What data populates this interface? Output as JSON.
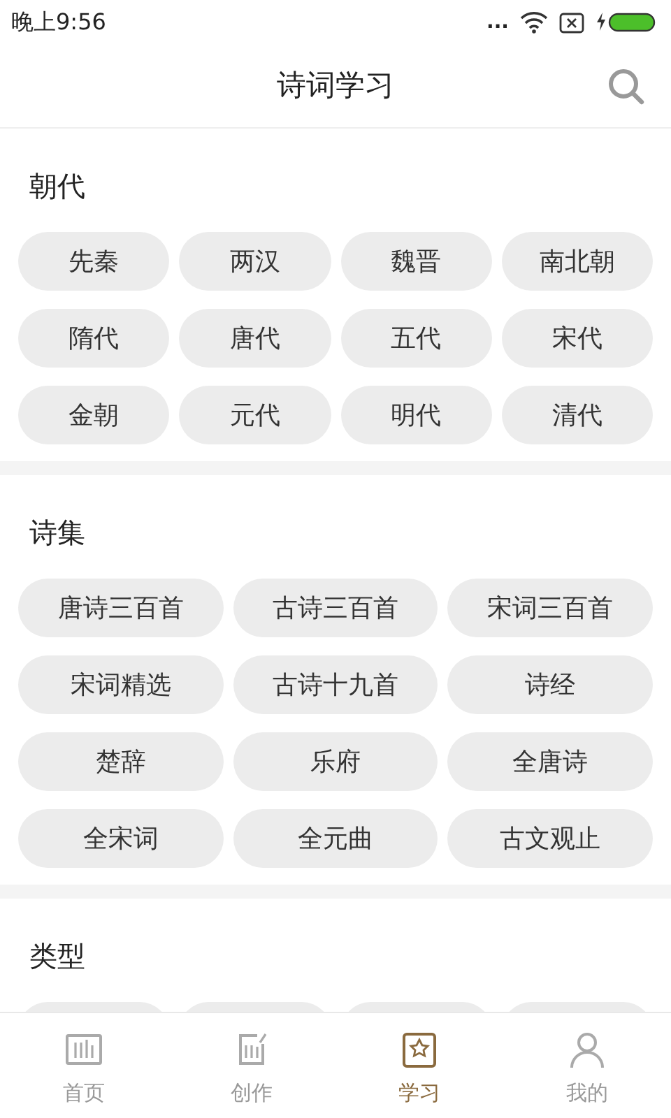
{
  "status_bar": {
    "time": "晚上9:56",
    "dots": "..."
  },
  "header": {
    "title": "诗词学习"
  },
  "sections": [
    {
      "title": "朝代",
      "kind": "short",
      "tags": [
        "先秦",
        "两汉",
        "魏晋",
        "南北朝",
        "隋代",
        "唐代",
        "五代",
        "宋代",
        "金朝",
        "元代",
        "明代",
        "清代"
      ]
    },
    {
      "title": "诗集",
      "kind": "long",
      "tags": [
        "唐诗三百首",
        "古诗三百首",
        "宋词三百首",
        "宋词精选",
        "古诗十九首",
        "诗经",
        "楚辞",
        "乐府",
        "全唐诗",
        "全宋词",
        "全元曲",
        "古文观止"
      ]
    },
    {
      "title": "类型",
      "kind": "short"
    }
  ],
  "tab_bar": [
    {
      "label": "首页",
      "kind": "book",
      "selected": false
    },
    {
      "label": "创作",
      "kind": "pen",
      "selected": false
    },
    {
      "label": "学习",
      "kind": "badge",
      "selected": true
    },
    {
      "label": "我的",
      "kind": "person",
      "selected": false
    }
  ]
}
